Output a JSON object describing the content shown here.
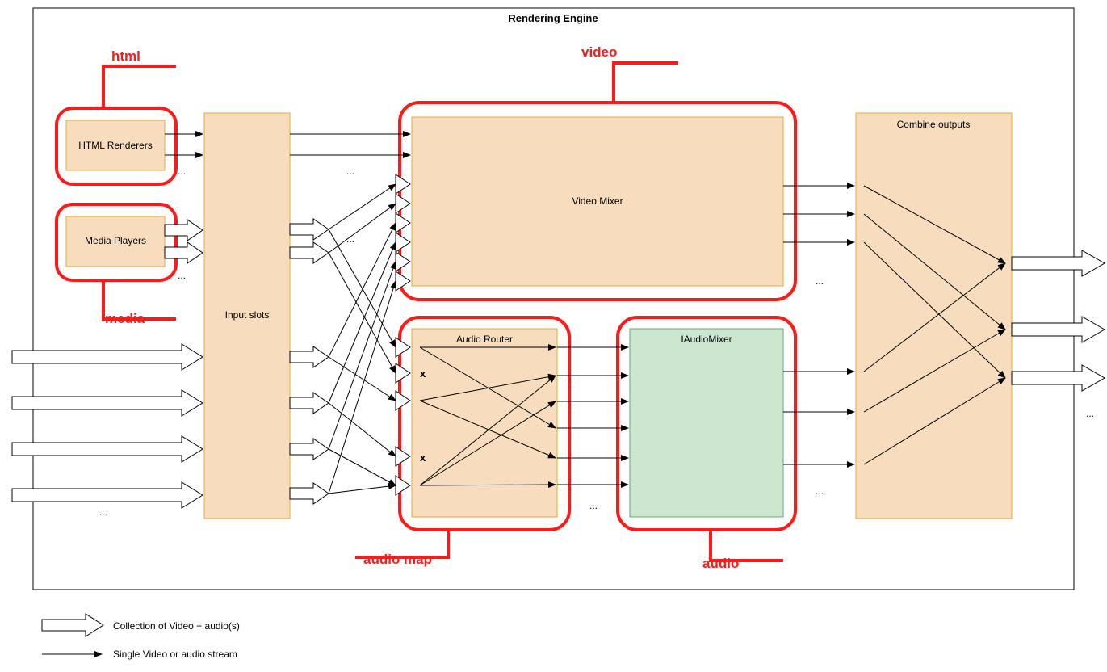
{
  "engine_title": "Rendering Engine",
  "boxes": {
    "html_renderers": "HTML Renderers",
    "media_players": "Media Players",
    "input_slots": "Input slots",
    "video_mixer": "Video Mixer",
    "audio_router": "Audio Router",
    "iaudio_mixer": "IAudioMixer",
    "combine_outputs": "Combine outputs"
  },
  "groups": {
    "html": "html",
    "media": "media",
    "video": "video",
    "audio_map": "audio map",
    "audio": "audio"
  },
  "legend": {
    "collection": "Collection of Video + audio(s)",
    "single": "Single Video or audio stream"
  },
  "dots": "...",
  "x_mark": "x"
}
